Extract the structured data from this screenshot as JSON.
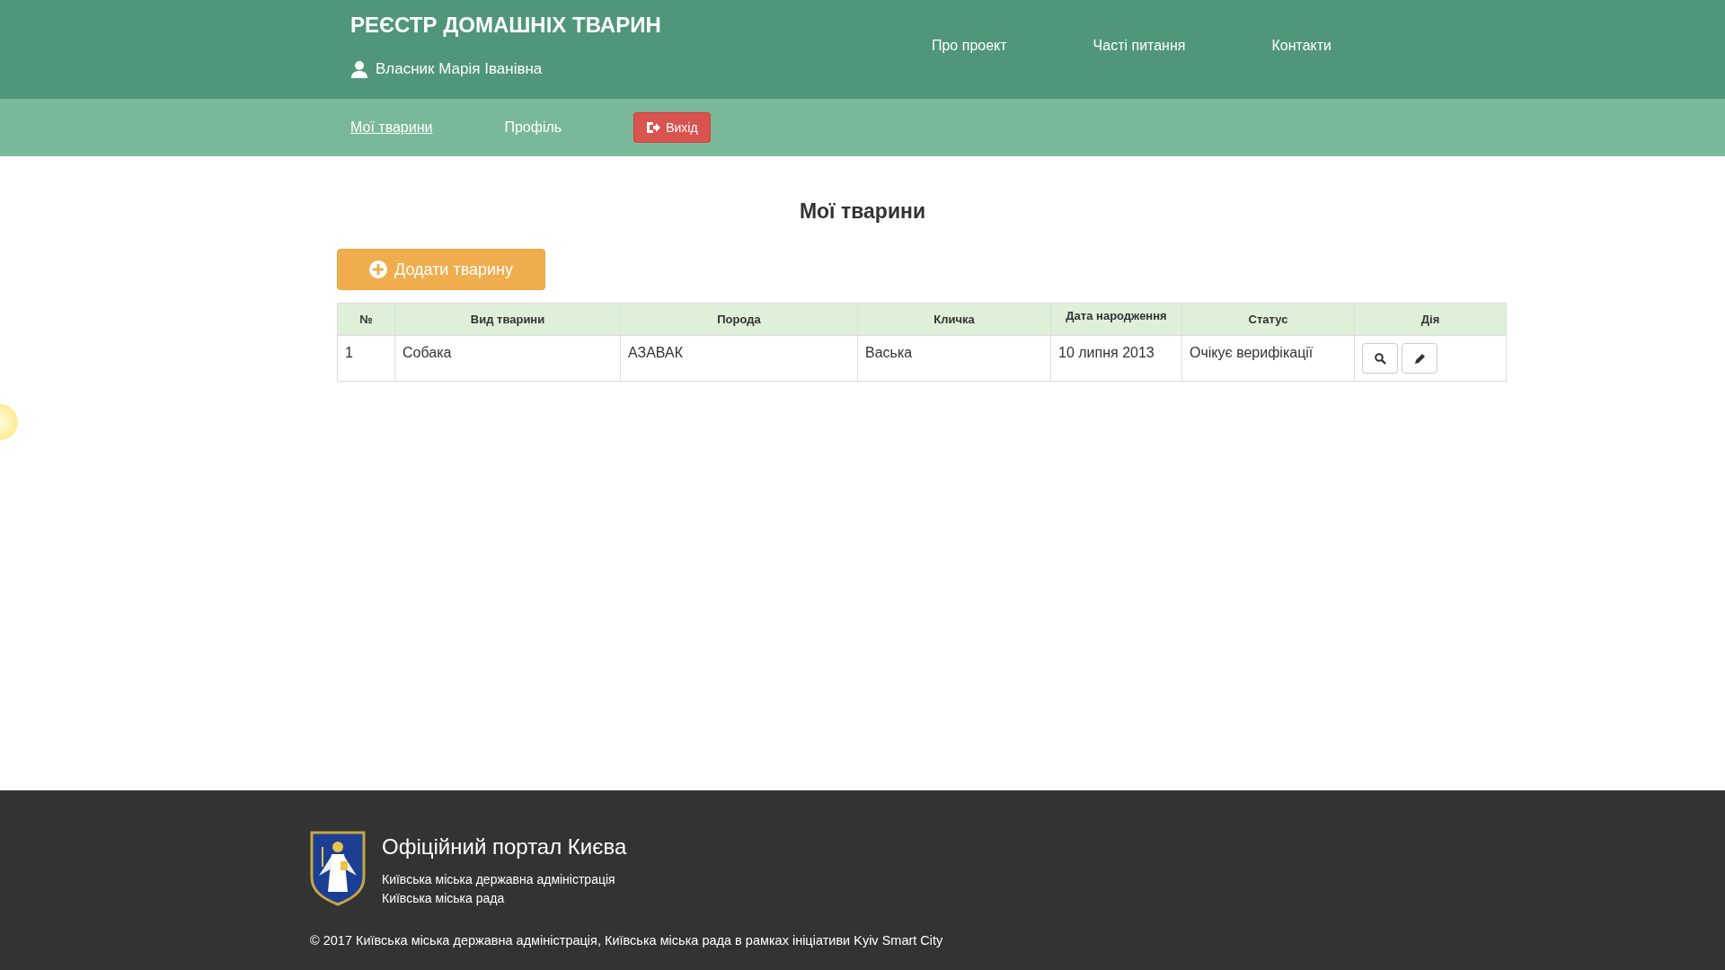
{
  "header": {
    "title": "РЕЄСТР ДОМАШНІХ ТВАРИН",
    "user": "Власник Марія Іванівна",
    "nav": [
      "Про проект",
      "Часті питання",
      "Контакти"
    ]
  },
  "subnav": {
    "items": [
      {
        "label": "Мої тварини",
        "selected": true
      },
      {
        "label": "Профіль",
        "selected": false
      }
    ],
    "logout": "Вихід"
  },
  "page": {
    "heading": "Мої тварини",
    "add_button": "Додати тварину"
  },
  "table": {
    "columns": [
      "№",
      "Вид тварини",
      "Порода",
      "Кличка",
      "Дата народження",
      "Статус",
      "Дія"
    ],
    "rows": [
      {
        "cells": [
          "1",
          "Собака",
          "АЗАВАК",
          "Васька",
          "10 липня 2013",
          "Очікує верифікації"
        ],
        "actions": [
          {
            "kind": "search"
          },
          {
            "kind": "edit"
          }
        ]
      }
    ]
  },
  "footer": {
    "title": "Офіційний портал Києва",
    "lines": [
      "Київська міська державна адміністрація",
      "Київська міська рада"
    ],
    "copyright": "© 2017 Київська міська державна адміністрація, Київська міська рада в рамках ініціативи Kyiv Smart City"
  }
}
